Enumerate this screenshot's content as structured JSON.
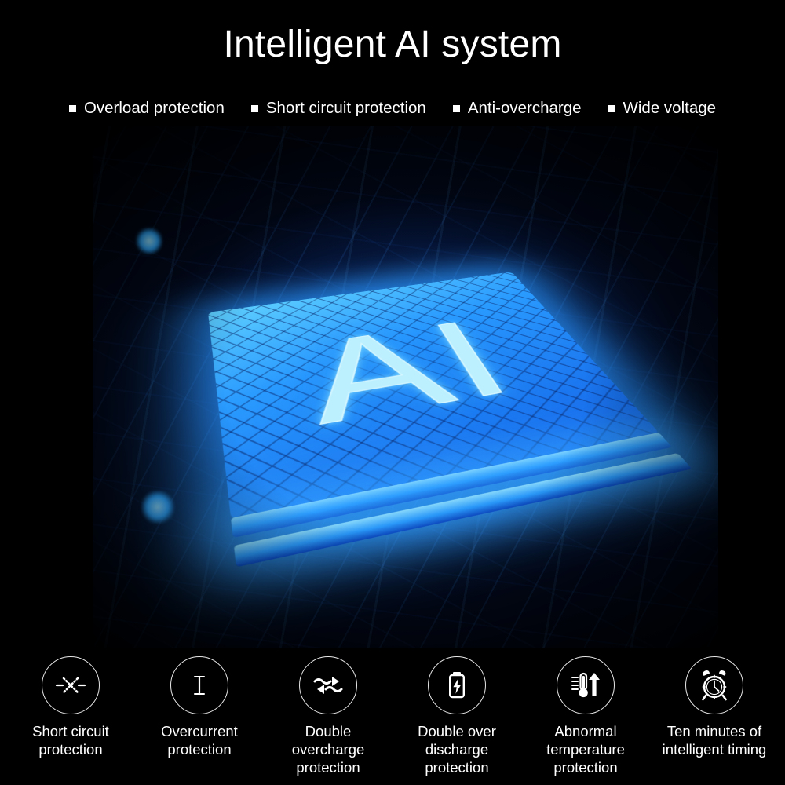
{
  "banner": {
    "background_color": "#000000",
    "accent_color": "#2a9bff",
    "text_color": "#ffffff"
  },
  "header": {
    "title": "Intelligent AI system"
  },
  "features": [
    {
      "bullet_icon": "square-bullet-icon",
      "label": "Overload protection"
    },
    {
      "bullet_icon": "square-bullet-icon",
      "label": "Short circuit protection"
    },
    {
      "bullet_icon": "square-bullet-icon",
      "label": "Anti-overcharge"
    },
    {
      "bullet_icon": "square-bullet-icon",
      "label": "Wide voltage"
    }
  ],
  "hero": {
    "chip_label": "AI",
    "alt": "Glowing blue AI processor chip on a circuit board",
    "glow_color": "#2a9bff"
  },
  "protections": [
    {
      "icon": "short-circuit-icon",
      "label": "Short circuit protection"
    },
    {
      "icon": "current-i-icon",
      "label": "Overcurrent protection"
    },
    {
      "icon": "double-wave-arrows-icon",
      "label": "Double overcharge protection"
    },
    {
      "icon": "battery-bolt-icon",
      "label": "Double over discharge protection"
    },
    {
      "icon": "thermometer-arrow-icon",
      "label": "Abnormal temperature protection"
    },
    {
      "icon": "alarm-clock-icon",
      "label": "Ten minutes of intelligent timing"
    }
  ]
}
